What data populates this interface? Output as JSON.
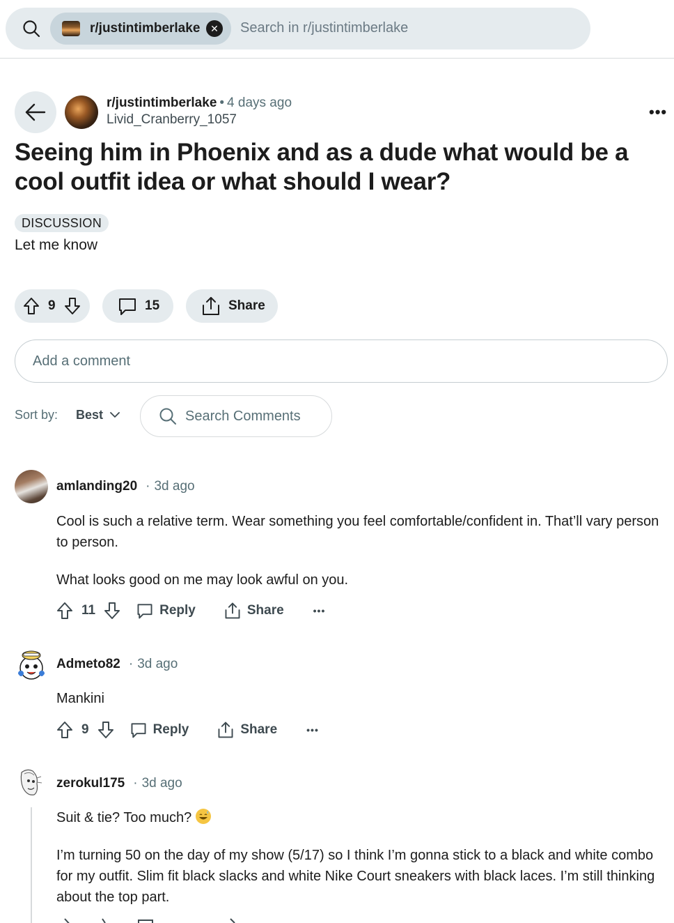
{
  "search": {
    "chip_label": "r/justintimberlake",
    "placeholder": "Search in r/justintimberlake"
  },
  "post": {
    "subreddit": "r/justintimberlake",
    "time": "4 days ago",
    "author": "Livid_Cranberry_1057",
    "title": "Seeing him in Phoenix and as a dude what would be a cool outfit idea or what should I wear?",
    "flair": "DISCUSSION",
    "body": "Let me know",
    "votes": "9",
    "comments": "15",
    "share_label": "Share"
  },
  "add_comment_placeholder": "Add a comment",
  "sort": {
    "label": "Sort by:",
    "value": "Best",
    "search_placeholder": "Search Comments"
  },
  "comments": [
    {
      "author": "amlanding20",
      "time": "3d ago",
      "paragraphs": [
        "Cool is such a relative term. Wear something you feel comfortable/confident in. That’ll vary person to person.",
        "What looks good on me may look awful on you."
      ],
      "votes": "11",
      "reply_label": "Reply",
      "share_label": "Share"
    },
    {
      "author": "Admeto82",
      "time": "3d ago",
      "paragraphs": [
        "Mankini"
      ],
      "votes": "9",
      "reply_label": "Reply",
      "share_label": "Share"
    },
    {
      "author": "zerokul175",
      "time": "3d ago",
      "paragraphs": [
        "Suit & tie? Too much?",
        "I’m turning 50 on the day of my show (5/17) so I think I’m gonna stick to a black and white combo for my outfit. Slim fit black slacks and white Nike Court sneakers with black laces. I’m still thinking about the top part."
      ]
    }
  ],
  "icons": {
    "search": "search-icon",
    "back": "arrow-left-icon",
    "more": "more-horizontal-icon",
    "upvote": "upvote-icon",
    "downvote": "downvote-icon",
    "comment": "comment-icon",
    "share": "share-icon",
    "close": "close-icon",
    "chevron": "chevron-down-icon",
    "emoji": "sweat-smile-emoji"
  }
}
